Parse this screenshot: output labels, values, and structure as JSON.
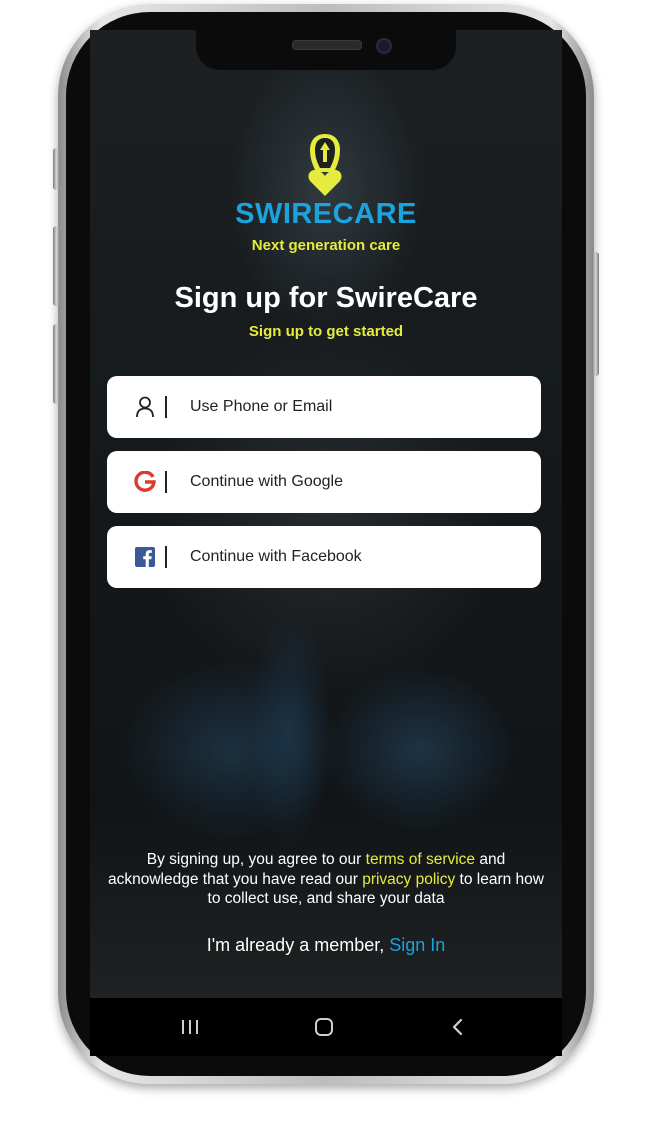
{
  "app": {
    "brand_name": "SWIRECARE",
    "tagline": "Next generation care",
    "brand_color": "#1aa3dd",
    "accent_color": "#e6ec3e"
  },
  "header": {
    "title": "Sign up for SwireCare",
    "subtitle": "Sign up to get started"
  },
  "auth_options": [
    {
      "label": "Use Phone or Email",
      "icon": "user-icon"
    },
    {
      "label": "Continue with Google",
      "icon": "google-icon"
    },
    {
      "label": "Continue with Facebook",
      "icon": "facebook-icon"
    }
  ],
  "terms": {
    "part1": "By signing up, you agree to our ",
    "tos_link": "terms of service",
    "part2": " and acknowledge that you have read our ",
    "privacy_link": "privacy policy",
    "part3": " to learn how to collect use, and share your data"
  },
  "footer": {
    "member_text": "I'm already a member, ",
    "signin_link": "Sign In"
  },
  "navbar": {
    "icons": [
      "recent-apps-icon",
      "home-icon",
      "back-icon"
    ]
  }
}
